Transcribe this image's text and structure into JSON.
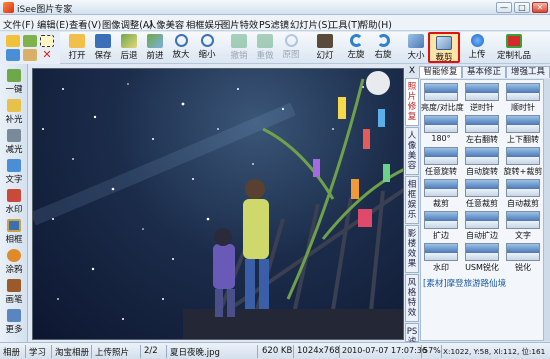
{
  "window": {
    "title": "iSee图片专家",
    "controls": [
      "—",
      "□",
      "✕"
    ]
  },
  "menu": [
    "文件(F)",
    "编辑(E)",
    "查看(V)",
    "图像调整(A)",
    "人像美容",
    "相框娱乐",
    "图片特效",
    "PS滤镜",
    "幻灯片(S)",
    "工具(T)",
    "帮助(H)"
  ],
  "toolbar": {
    "open": "打开",
    "save": "保存",
    "back": "后退",
    "forward": "前进",
    "zoom_in": "放大",
    "zoom_out": "缩小",
    "undo": "撤销",
    "redo": "重做",
    "original": "原图",
    "slideshow": "幻灯",
    "rotate_left": "左旋",
    "rotate_right": "右旋",
    "resize": "大小",
    "crop": "裁剪",
    "upload": "上传",
    "custom_gift": "定制礼品"
  },
  "sidebar": [
    "一键",
    "补光",
    "减光",
    "文字",
    "水印",
    "相框",
    "涂鸦",
    "画笔",
    "更多"
  ],
  "right_panel": {
    "close": "X",
    "top_tabs": [
      "智能修复",
      "基本修正",
      "增强工具"
    ],
    "vertical_tabs": [
      "照片修复",
      "人像美容",
      "相框娱乐",
      "影楼效果",
      "风格特效",
      "PS滤"
    ],
    "tools": [
      "亮度/对比度",
      "逆时针",
      "顺时针",
      "180°",
      "左右翻转",
      "上下翻转",
      "任意旋转",
      "自动旋转",
      "旋转+裁剪",
      "裁剪",
      "任意裁剪",
      "自动裁剪",
      "扩边",
      "自动扩边",
      "文字",
      "水印",
      "USM锐化",
      "锐化"
    ],
    "footer": "[素材]摩登旅游路仙境"
  },
  "status": {
    "album": "相册",
    "study": "学习",
    "taobao": "淘宝相册",
    "upload": "上传照片",
    "index": "2/2",
    "filename": "夏日夜晚.jpg",
    "size": "620 KB",
    "dimensions": "1024x768",
    "datetime": "2010-07-07 17:07:36",
    "zoom": "57%",
    "coords": "X:1022, Y:58, Xl:112, 位:161"
  },
  "colors": {
    "highlight": "#e01010",
    "accent": "#1a5aa8"
  }
}
